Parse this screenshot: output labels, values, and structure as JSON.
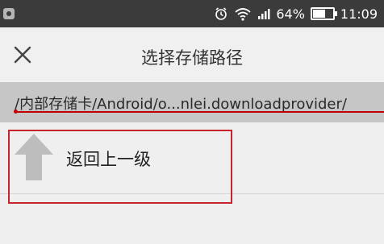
{
  "status_bar": {
    "battery_percent": "64%",
    "battery_level": 0.64,
    "time": "11:09",
    "icons": [
      "app-icon",
      "alarm-icon",
      "wifi-icon",
      "signal-icon",
      "battery-icon"
    ]
  },
  "title_bar": {
    "title": "选择存储路径",
    "close_icon": "close-icon"
  },
  "path_bar": {
    "path": "/内部存储卡/Android/o...nlei.downloadprovider/"
  },
  "list": {
    "up_item": {
      "label": "返回上一级",
      "icon": "up-arrow-icon"
    }
  },
  "colors": {
    "status_bar_bg": "#3b3b3b",
    "title_bar_bg": "#f0f0f0",
    "path_bar_bg": "#c6c6c6",
    "annotation_red": "#c8232c",
    "up_arrow": "#bdbdbd"
  }
}
